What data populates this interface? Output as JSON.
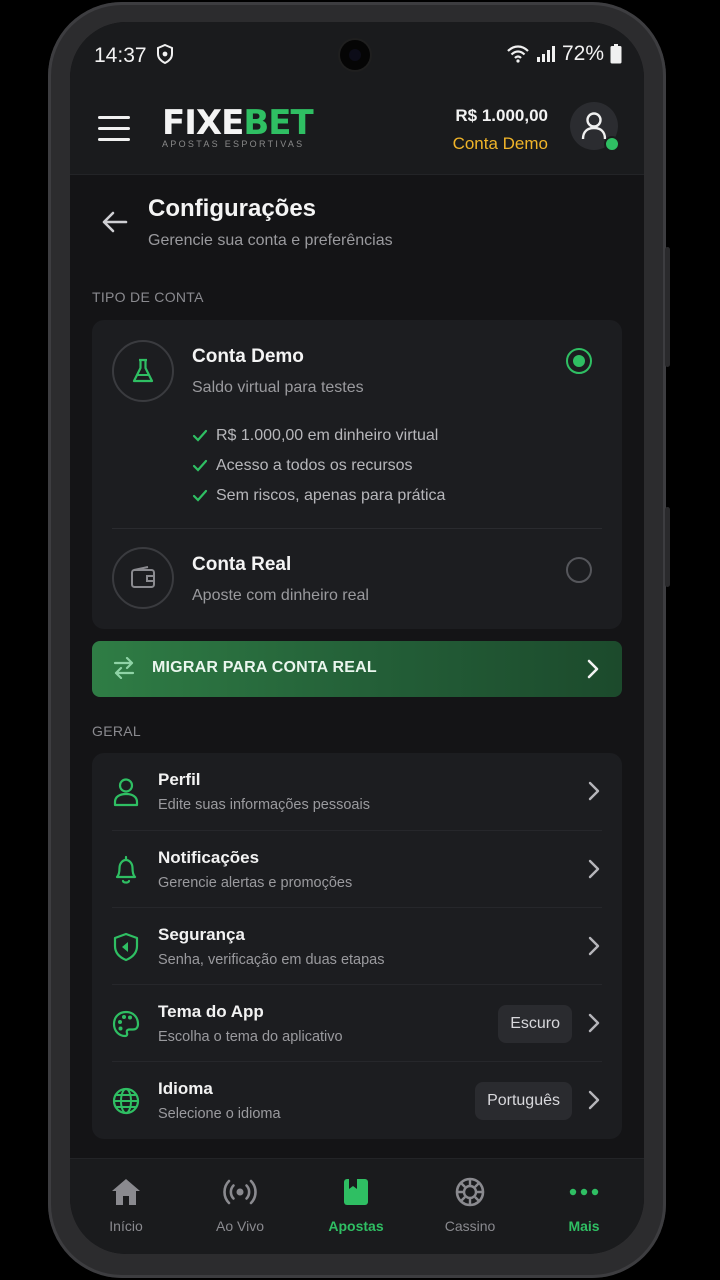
{
  "status_bar": {
    "time": "14:37",
    "battery": "72%"
  },
  "header": {
    "logo_part1": "FIXE",
    "logo_part2": "BET",
    "logo_tagline": "APOSTAS ESPORTIVAS",
    "balance": "R$ 1.000,00",
    "account_label": "Conta Demo"
  },
  "page": {
    "title": "Configurações",
    "subtitle": "Gerencie sua conta e preferências"
  },
  "account_section": {
    "label": "TIPO DE CONTA",
    "demo": {
      "title": "Conta Demo",
      "subtitle": "Saldo virtual para testes",
      "selected": true,
      "features": [
        "R$ 1.000,00 em dinheiro virtual",
        "Acesso a todos os recursos",
        "Sem riscos, apenas para prática"
      ]
    },
    "real": {
      "title": "Conta Real",
      "subtitle": "Aposte com dinheiro real",
      "selected": false
    },
    "migrate_label": "MIGRAR PARA CONTA REAL"
  },
  "general_section": {
    "label": "GERAL",
    "items": [
      {
        "title": "Perfil",
        "subtitle": "Edite suas informações pessoais"
      },
      {
        "title": "Notificações",
        "subtitle": "Gerencie alertas e promoções"
      },
      {
        "title": "Segurança",
        "subtitle": "Senha, verificação em duas etapas"
      },
      {
        "title": "Tema do App",
        "subtitle": "Escolha o tema do aplicativo",
        "value": "Escuro"
      },
      {
        "title": "Idioma",
        "subtitle": "Selecione o idioma",
        "value": "Português"
      }
    ]
  },
  "bottom_nav": [
    {
      "label": "Início",
      "icon": "home-icon"
    },
    {
      "label": "Ao Vivo",
      "icon": "live-icon"
    },
    {
      "label": "Apostas",
      "icon": "bets-icon",
      "active": true
    },
    {
      "label": "Cassino",
      "icon": "casino-icon"
    },
    {
      "label": "Mais",
      "icon": "more-icon"
    }
  ],
  "colors": {
    "accent": "#2fbf63",
    "demo_label": "#f0b429",
    "background": "#141416",
    "card": "#1c1d20"
  }
}
